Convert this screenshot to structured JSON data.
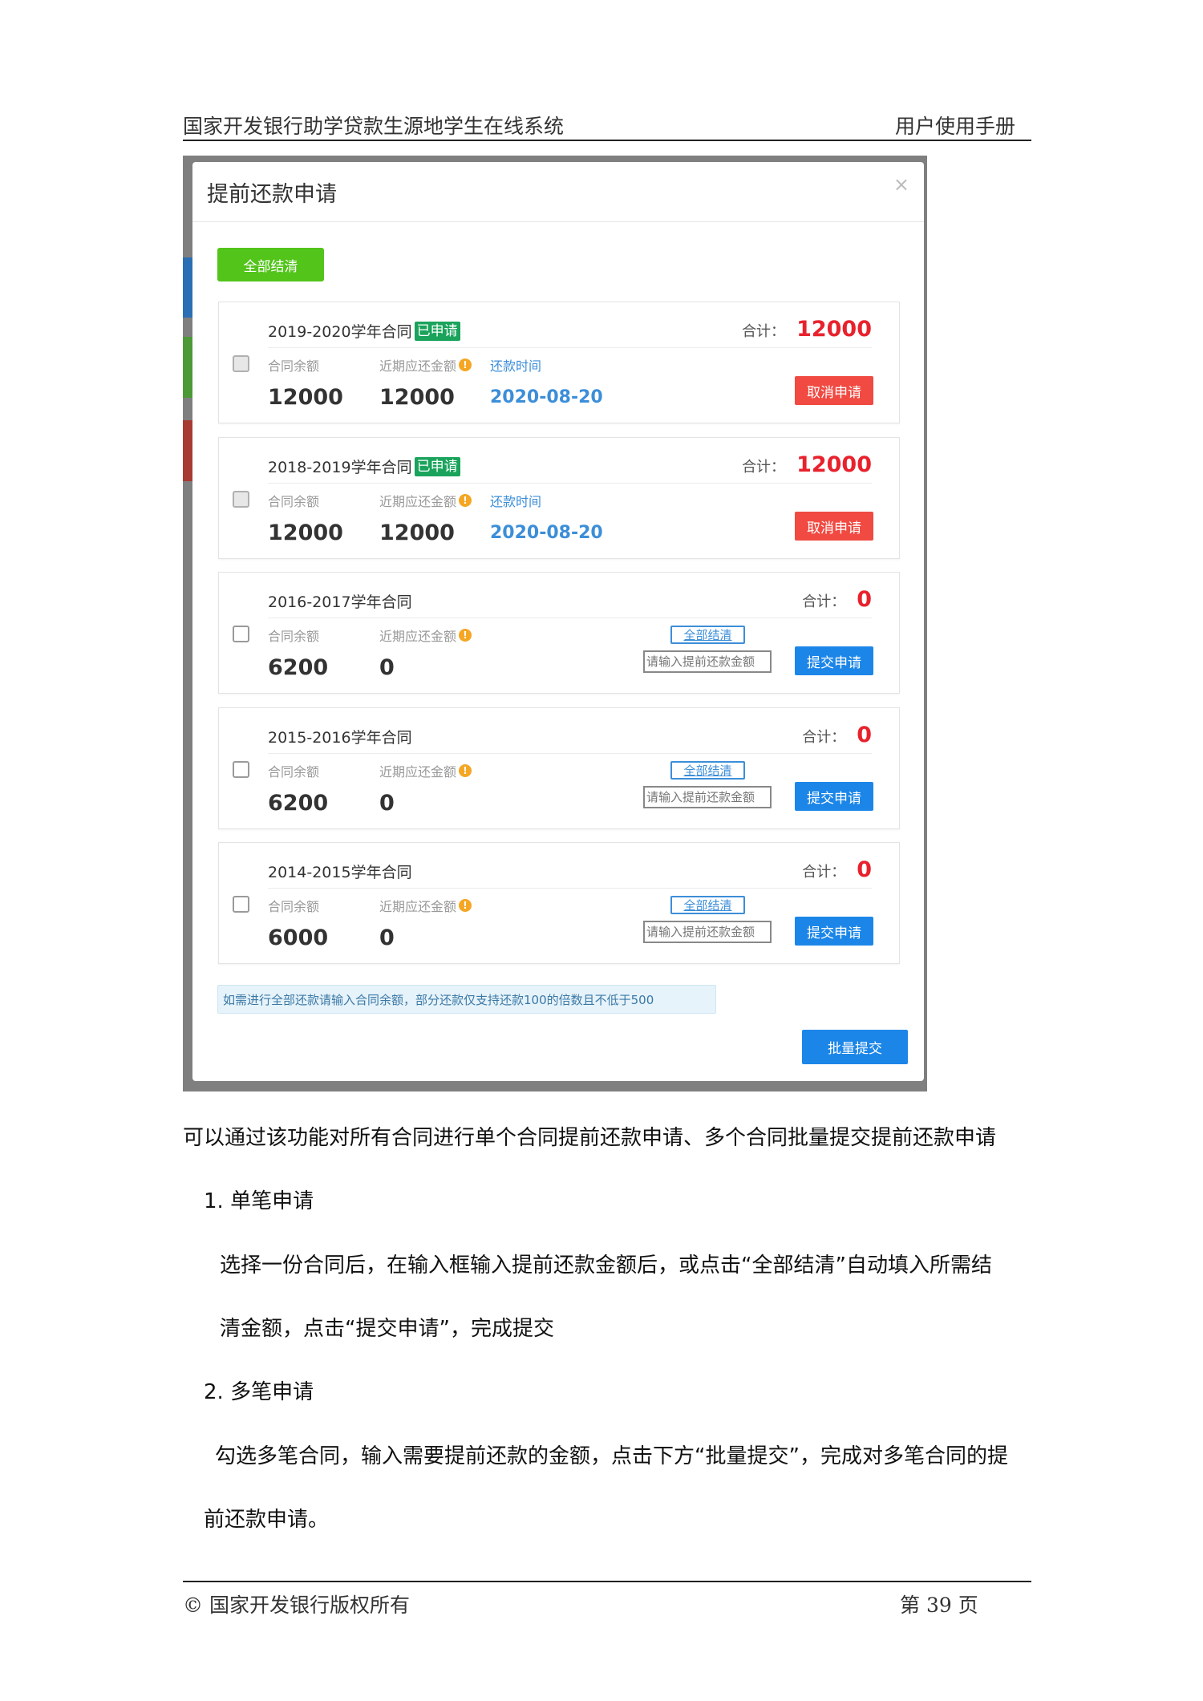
{
  "header": {
    "title": "国家开发银行助学贷款生源地学生在线系统",
    "manual": "用户使用手册"
  },
  "modal": {
    "title": "提前还款申请",
    "close_glyph": "×",
    "settle_all_button": "全部结清",
    "notice": "如需进行全部还款请输入合同余额，部分还款仅支持还款100的倍数且不低于500",
    "batch_submit_button": "批量提交",
    "contracts": [
      {
        "name": "2019-2020学年合同",
        "badge": "已申请",
        "total_label": "合计：",
        "total": "12000",
        "balance_label": "合同余额",
        "due_label": "近期应还金额",
        "date_label": "还款时间",
        "balance": "12000",
        "due": "12000",
        "date": "2020-08-20",
        "action": "取消申请"
      },
      {
        "name": "2018-2019学年合同",
        "badge": "已申请",
        "total_label": "合计：",
        "total": "12000",
        "balance_label": "合同余额",
        "due_label": "近期应还金额",
        "date_label": "还款时间",
        "balance": "12000",
        "due": "12000",
        "date": "2020-08-20",
        "action": "取消申请"
      },
      {
        "name": "2016-2017学年合同",
        "total_label": "合计：",
        "total": "0",
        "balance_label": "合同余额",
        "due_label": "近期应还金额",
        "balance": "6200",
        "due": "0",
        "settle_link": "全部结清",
        "input_placeholder": "请输入提前还款金额",
        "action": "提交申请"
      },
      {
        "name": "2015-2016学年合同",
        "total_label": "合计：",
        "total": "0",
        "balance_label": "合同余额",
        "due_label": "近期应还金额",
        "balance": "6200",
        "due": "0",
        "settle_link": "全部结清",
        "input_placeholder": "请输入提前还款金额",
        "action": "提交申请"
      },
      {
        "name": "2014-2015学年合同",
        "total_label": "合计：",
        "total": "0",
        "balance_label": "合同余额",
        "due_label": "近期应还金额",
        "balance": "6000",
        "due": "0",
        "settle_link": "全部结清",
        "input_placeholder": "请输入提前还款金额",
        "action": "提交申请"
      }
    ]
  },
  "body": {
    "intro": "可以通过该功能对所有合同进行单个合同提前还款申请、多个合同批量提交提前还款申请",
    "item1_title": "1.   单笔申请",
    "item1_line1": "选择一份合同后，在输入框输入提前还款金额后，或点击“全部结清”自动填入所需结",
    "item1_line2": "清金额，点击“提交申请”，完成提交",
    "item2_title": "2.   多笔申请",
    "item2_line1": "勾选多笔合同，输入需要提前还款的金额，点击下方“批量提交”，完成对多笔合同的提",
    "item2_line2": "前还款申请。"
  },
  "footer": {
    "copyright": "©  国家开发银行版权所有",
    "page": "第 39 页"
  },
  "colors": {
    "green": "#52c41a",
    "badge_green": "#1aa35b",
    "red": "#f04a42",
    "total_red": "#e8222d",
    "blue": "#1c86e8",
    "link_blue": "#3c8ed8",
    "info_orange": "#f5a623"
  }
}
